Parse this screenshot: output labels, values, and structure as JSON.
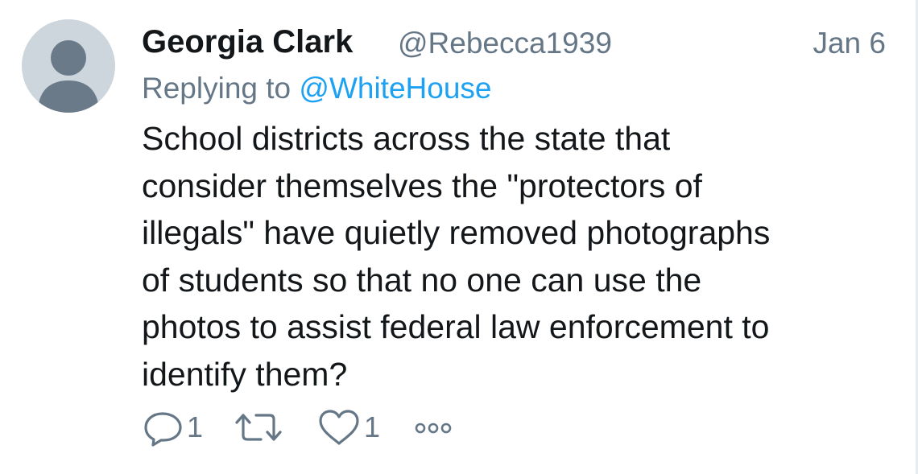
{
  "tweet": {
    "author_name": "Georgia Clark",
    "author_handle": "@Rebecca1939",
    "date": "Jan 6",
    "replying_prefix": "Replying to",
    "replying_to": "@WhiteHouse",
    "text_lines": [
      "School districts across the state that",
      "consider themselves the \"protectors of",
      "illegals\" have quietly removed photographs",
      "of students so that no one can use the",
      "photos to assist federal law enforcement to",
      "identify them?"
    ]
  },
  "actions": {
    "reply_icon": "reply-icon",
    "reply_count": "1",
    "retweet_icon": "retweet-icon",
    "retweet_count": "",
    "like_icon": "heart-icon",
    "like_count": "1",
    "more_icon": "more-icon"
  },
  "colors": {
    "text": "#14171a",
    "secondary": "#657786",
    "link": "#1da1f2",
    "avatar_bg": "#cdd6dd",
    "avatar_fg": "#6a7a89"
  }
}
